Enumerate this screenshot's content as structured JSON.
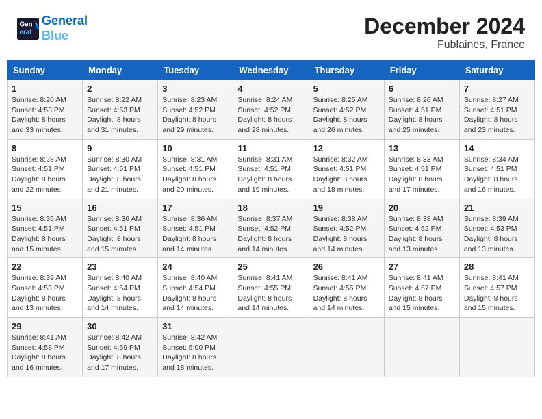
{
  "header": {
    "logo_line1": "General",
    "logo_line2": "Blue",
    "month": "December 2024",
    "location": "Fublaines, France"
  },
  "weekdays": [
    "Sunday",
    "Monday",
    "Tuesday",
    "Wednesday",
    "Thursday",
    "Friday",
    "Saturday"
  ],
  "weeks": [
    [
      {
        "day": 1,
        "sunrise": "8:20 AM",
        "sunset": "4:53 PM",
        "daylight": "8 hours and 33 minutes."
      },
      {
        "day": 2,
        "sunrise": "8:22 AM",
        "sunset": "4:53 PM",
        "daylight": "8 hours and 31 minutes."
      },
      {
        "day": 3,
        "sunrise": "8:23 AM",
        "sunset": "4:52 PM",
        "daylight": "8 hours and 29 minutes."
      },
      {
        "day": 4,
        "sunrise": "8:24 AM",
        "sunset": "4:52 PM",
        "daylight": "8 hours and 28 minutes."
      },
      {
        "day": 5,
        "sunrise": "8:25 AM",
        "sunset": "4:52 PM",
        "daylight": "8 hours and 26 minutes."
      },
      {
        "day": 6,
        "sunrise": "8:26 AM",
        "sunset": "4:51 PM",
        "daylight": "8 hours and 25 minutes."
      },
      {
        "day": 7,
        "sunrise": "8:27 AM",
        "sunset": "4:51 PM",
        "daylight": "8 hours and 23 minutes."
      }
    ],
    [
      {
        "day": 8,
        "sunrise": "8:28 AM",
        "sunset": "4:51 PM",
        "daylight": "8 hours and 22 minutes."
      },
      {
        "day": 9,
        "sunrise": "8:30 AM",
        "sunset": "4:51 PM",
        "daylight": "8 hours and 21 minutes."
      },
      {
        "day": 10,
        "sunrise": "8:31 AM",
        "sunset": "4:51 PM",
        "daylight": "8 hours and 20 minutes."
      },
      {
        "day": 11,
        "sunrise": "8:31 AM",
        "sunset": "4:51 PM",
        "daylight": "8 hours and 19 minutes."
      },
      {
        "day": 12,
        "sunrise": "8:32 AM",
        "sunset": "4:51 PM",
        "daylight": "8 hours and 18 minutes."
      },
      {
        "day": 13,
        "sunrise": "8:33 AM",
        "sunset": "4:51 PM",
        "daylight": "8 hours and 17 minutes."
      },
      {
        "day": 14,
        "sunrise": "8:34 AM",
        "sunset": "4:51 PM",
        "daylight": "8 hours and 16 minutes."
      }
    ],
    [
      {
        "day": 15,
        "sunrise": "8:35 AM",
        "sunset": "4:51 PM",
        "daylight": "8 hours and 15 minutes."
      },
      {
        "day": 16,
        "sunrise": "8:36 AM",
        "sunset": "4:51 PM",
        "daylight": "8 hours and 15 minutes."
      },
      {
        "day": 17,
        "sunrise": "8:36 AM",
        "sunset": "4:51 PM",
        "daylight": "8 hours and 14 minutes."
      },
      {
        "day": 18,
        "sunrise": "8:37 AM",
        "sunset": "4:52 PM",
        "daylight": "8 hours and 14 minutes."
      },
      {
        "day": 19,
        "sunrise": "8:38 AM",
        "sunset": "4:52 PM",
        "daylight": "8 hours and 14 minutes."
      },
      {
        "day": 20,
        "sunrise": "8:38 AM",
        "sunset": "4:52 PM",
        "daylight": "8 hours and 13 minutes."
      },
      {
        "day": 21,
        "sunrise": "8:39 AM",
        "sunset": "4:53 PM",
        "daylight": "8 hours and 13 minutes."
      }
    ],
    [
      {
        "day": 22,
        "sunrise": "8:39 AM",
        "sunset": "4:53 PM",
        "daylight": "8 hours and 13 minutes."
      },
      {
        "day": 23,
        "sunrise": "8:40 AM",
        "sunset": "4:54 PM",
        "daylight": "8 hours and 14 minutes."
      },
      {
        "day": 24,
        "sunrise": "8:40 AM",
        "sunset": "4:54 PM",
        "daylight": "8 hours and 14 minutes."
      },
      {
        "day": 25,
        "sunrise": "8:41 AM",
        "sunset": "4:55 PM",
        "daylight": "8 hours and 14 minutes."
      },
      {
        "day": 26,
        "sunrise": "8:41 AM",
        "sunset": "4:56 PM",
        "daylight": "8 hours and 14 minutes."
      },
      {
        "day": 27,
        "sunrise": "8:41 AM",
        "sunset": "4:57 PM",
        "daylight": "8 hours and 15 minutes."
      },
      {
        "day": 28,
        "sunrise": "8:41 AM",
        "sunset": "4:57 PM",
        "daylight": "8 hours and 15 minutes."
      }
    ],
    [
      {
        "day": 29,
        "sunrise": "8:41 AM",
        "sunset": "4:58 PM",
        "daylight": "8 hours and 16 minutes."
      },
      {
        "day": 30,
        "sunrise": "8:42 AM",
        "sunset": "4:59 PM",
        "daylight": "8 hours and 17 minutes."
      },
      {
        "day": 31,
        "sunrise": "8:42 AM",
        "sunset": "5:00 PM",
        "daylight": "8 hours and 18 minutes."
      },
      null,
      null,
      null,
      null
    ]
  ]
}
